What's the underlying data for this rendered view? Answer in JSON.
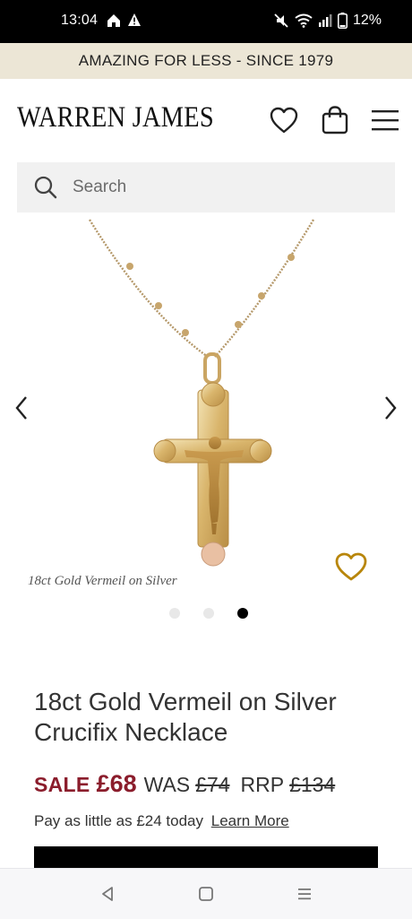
{
  "status_bar": {
    "time": "13:04",
    "battery": "12%"
  },
  "promo": {
    "text": "AMAZING FOR LESS - SINCE 1979"
  },
  "header": {
    "logo": "WARREN JAMES",
    "icons": [
      "heart-icon",
      "shopping-bag-icon",
      "menu-icon"
    ]
  },
  "search": {
    "placeholder": "Search"
  },
  "gallery": {
    "caption": "18ct Gold Vermeil on Silver",
    "slide_count": 3,
    "active_slide": 3
  },
  "product": {
    "title_line1": "18ct Gold Vermeil on Silver",
    "title_line2": "Crucifix Necklace"
  },
  "price": {
    "sale_label": "SALE",
    "sale_price": "£68",
    "was_label": "WAS",
    "was_price": "£74",
    "rrp_label": "RRP",
    "rrp_price": "£134"
  },
  "payment": {
    "text": "Pay as little as £24 today",
    "link": "Learn More"
  },
  "colors": {
    "promo_bg": "#ece6d6",
    "sale_red": "#8b1d2c",
    "wishlist_gold": "#b8860b"
  }
}
